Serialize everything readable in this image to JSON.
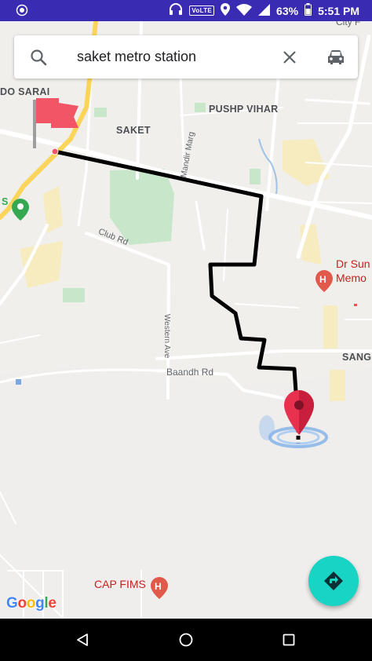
{
  "status_bar": {
    "volte": "VoLTE",
    "battery": "63%",
    "time": "5:51 PM",
    "icons": [
      "notification-icon",
      "headphones-icon",
      "location-icon",
      "wifi-icon",
      "signal-icon",
      "battery-icon"
    ]
  },
  "search": {
    "query": "saket metro station",
    "icons": [
      "search-icon",
      "close-icon",
      "car-icon"
    ]
  },
  "map": {
    "labels": {
      "do_sarai": "DO SARAI",
      "pushp_vihar": "PUSHP VIHAR",
      "saket": "SAKET",
      "mandir_marg": "Mandir Marg",
      "club_rd": "Club Rd",
      "western_ave": "Western Ave",
      "baandh_rd": "Baandh Rd",
      "dr_sun": "Dr Sun",
      "memo": "Memo",
      "sang": "SANG",
      "cap_fims": "CAP FIMS",
      "city": "City F",
      "s": "S"
    },
    "colors": {
      "route": "#000000",
      "marker": "#e8304f",
      "flag": "#f25565",
      "hospital": "#e0594a",
      "park": "#c8e6c9",
      "accent_fab": "#18d4c4"
    }
  },
  "google_logo": {
    "letters": [
      "G",
      "o",
      "o",
      "g",
      "l",
      "e"
    ]
  },
  "fab": {
    "icon": "directions-icon"
  },
  "nav_bar": {
    "icons": [
      "back-icon",
      "home-icon",
      "recent-apps-icon"
    ]
  }
}
